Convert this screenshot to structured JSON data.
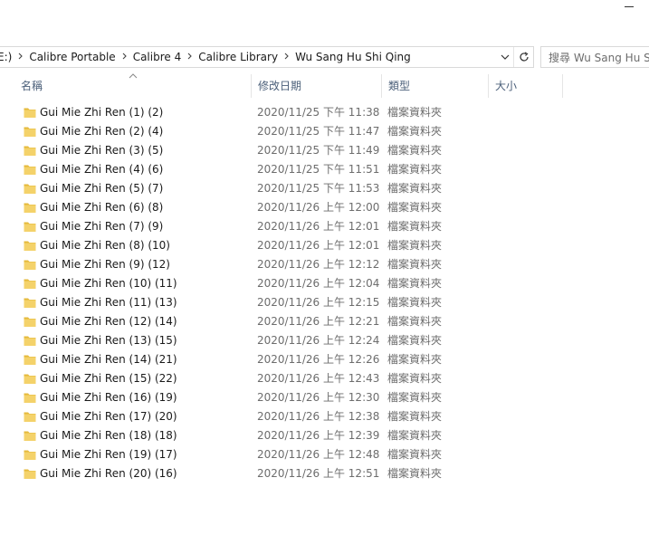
{
  "address": {
    "crumbs": [
      "E:)",
      "Calibre Portable",
      "Calibre 4",
      "Calibre Library",
      "Wu Sang Hu Shi Qing"
    ]
  },
  "search": {
    "placeholder": "搜尋 Wu Sang Hu Shi Qing"
  },
  "columns": {
    "name": "名稱",
    "date": "修改日期",
    "type": "類型",
    "size": "大小"
  },
  "icons": {
    "folder": "folder-icon",
    "sort": "sort-ascending-icon",
    "dropdown": "chevron-down-icon",
    "refresh": "refresh-icon",
    "separator": "chevron-right-icon"
  },
  "colors": {
    "folder": "#f4d26a",
    "folder_dark": "#e5b93b",
    "header_text": "#4c607a",
    "meta_text": "#6d6d6d"
  },
  "files": [
    {
      "name": "Gui Mie Zhi Ren  (1) (2)",
      "date": "2020/11/25 下午 11:38",
      "type": "檔案資料夾"
    },
    {
      "name": "Gui Mie Zhi Ren  (2) (4)",
      "date": "2020/11/25 下午 11:47",
      "type": "檔案資料夾"
    },
    {
      "name": "Gui Mie Zhi Ren  (3) (5)",
      "date": "2020/11/25 下午 11:49",
      "type": "檔案資料夾"
    },
    {
      "name": "Gui Mie Zhi Ren  (4) (6)",
      "date": "2020/11/25 下午 11:51",
      "type": "檔案資料夾"
    },
    {
      "name": "Gui Mie Zhi Ren  (5) (7)",
      "date": "2020/11/25 下午 11:53",
      "type": "檔案資料夾"
    },
    {
      "name": "Gui Mie Zhi Ren  (6) (8)",
      "date": "2020/11/26 上午 12:00",
      "type": "檔案資料夾"
    },
    {
      "name": "Gui Mie Zhi Ren  (7) (9)",
      "date": "2020/11/26 上午 12:01",
      "type": "檔案資料夾"
    },
    {
      "name": "Gui Mie Zhi Ren  (8) (10)",
      "date": "2020/11/26 上午 12:01",
      "type": "檔案資料夾"
    },
    {
      "name": "Gui Mie Zhi Ren  (9) (12)",
      "date": "2020/11/26 上午 12:12",
      "type": "檔案資料夾"
    },
    {
      "name": "Gui Mie Zhi Ren  (10) (11)",
      "date": "2020/11/26 上午 12:04",
      "type": "檔案資料夾"
    },
    {
      "name": "Gui Mie Zhi Ren  (11) (13)",
      "date": "2020/11/26 上午 12:15",
      "type": "檔案資料夾"
    },
    {
      "name": "Gui Mie Zhi Ren  (12) (14)",
      "date": "2020/11/26 上午 12:21",
      "type": "檔案資料夾"
    },
    {
      "name": "Gui Mie Zhi Ren  (13) (15)",
      "date": "2020/11/26 上午 12:24",
      "type": "檔案資料夾"
    },
    {
      "name": "Gui Mie Zhi Ren  (14) (21)",
      "date": "2020/11/26 上午 12:26",
      "type": "檔案資料夾"
    },
    {
      "name": "Gui Mie Zhi Ren  (15) (22)",
      "date": "2020/11/26 上午 12:43",
      "type": "檔案資料夾"
    },
    {
      "name": "Gui Mie Zhi Ren  (16) (19)",
      "date": "2020/11/26 上午 12:30",
      "type": "檔案資料夾"
    },
    {
      "name": "Gui Mie Zhi Ren  (17) (20)",
      "date": "2020/11/26 上午 12:38",
      "type": "檔案資料夾"
    },
    {
      "name": "Gui Mie Zhi Ren  (18) (18)",
      "date": "2020/11/26 上午 12:39",
      "type": "檔案資料夾"
    },
    {
      "name": "Gui Mie Zhi Ren  (19) (17)",
      "date": "2020/11/26 上午 12:48",
      "type": "檔案資料夾"
    },
    {
      "name": "Gui Mie Zhi Ren  (20) (16)",
      "date": "2020/11/26 上午 12:51",
      "type": "檔案資料夾"
    }
  ]
}
